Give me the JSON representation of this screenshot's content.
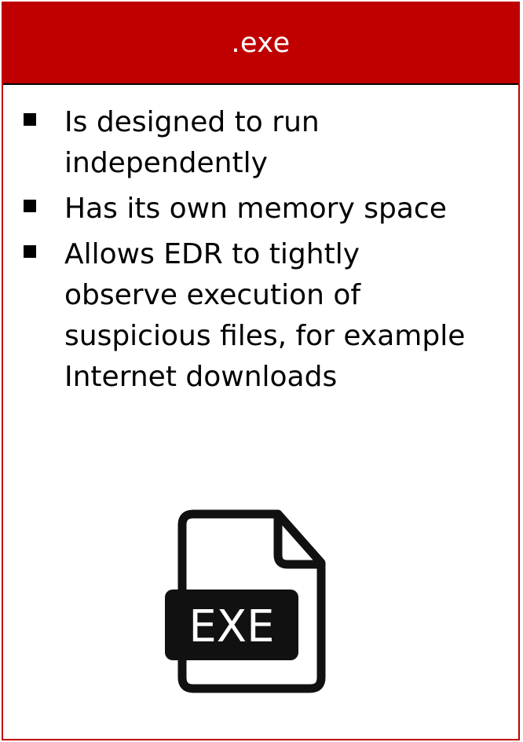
{
  "card": {
    "title": ".exe",
    "accent_color": "#c00000",
    "bullets": [
      {
        "line1": "Is designed to run",
        "line2": "independently"
      },
      {
        "line1": "Has its own memory space"
      },
      {
        "line1": "Allows EDR to tightly",
        "line2": "observe execution of",
        "line3": "suspicious files, for example",
        "line4": "Internet downloads"
      }
    ],
    "icon": {
      "name": "exe-file-icon",
      "label": "EXE"
    }
  }
}
